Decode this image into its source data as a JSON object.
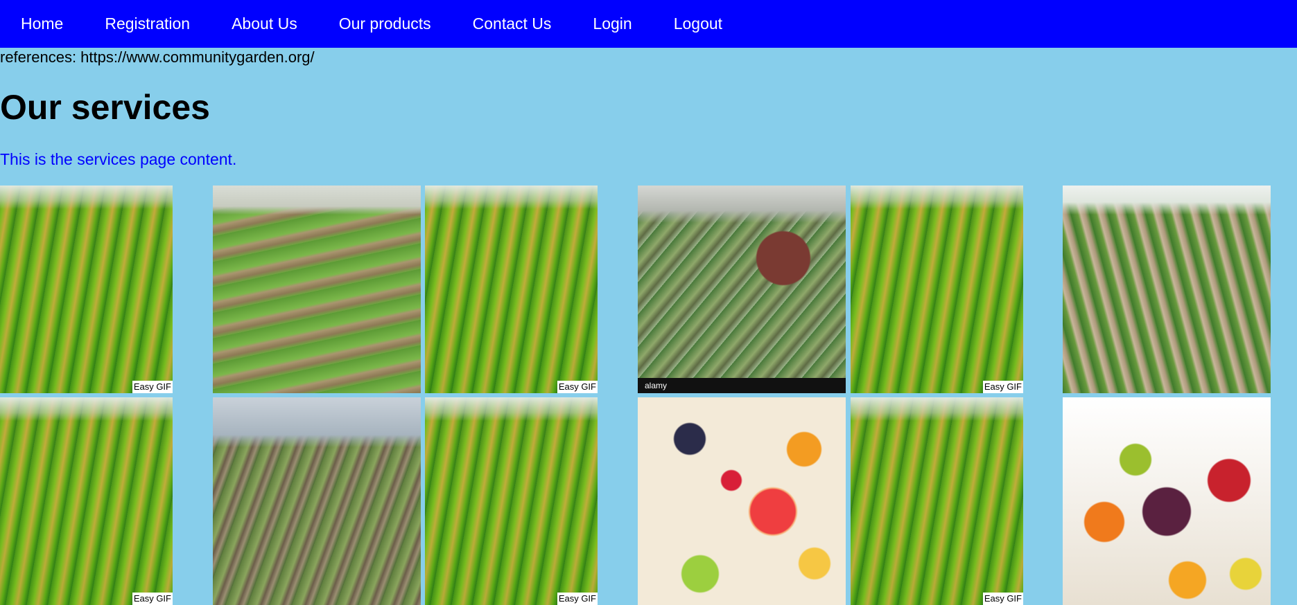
{
  "nav": {
    "items": [
      {
        "label": "Home"
      },
      {
        "label": "Registration"
      },
      {
        "label": "About Us"
      },
      {
        "label": "Our products"
      },
      {
        "label": "Contact Us"
      },
      {
        "label": "Login"
      },
      {
        "label": "Logout"
      }
    ],
    "background_color": "#0000ff",
    "text_color": "#ffffff"
  },
  "references": "references: https://www.communitygarden.org/",
  "page": {
    "title": "Our services",
    "description": "This is the services page content.",
    "background_color": "#87ceeb",
    "description_color": "#0000ff"
  },
  "gallery": {
    "badge_label": "Easy GIF",
    "alamy_label": "alamy"
  }
}
